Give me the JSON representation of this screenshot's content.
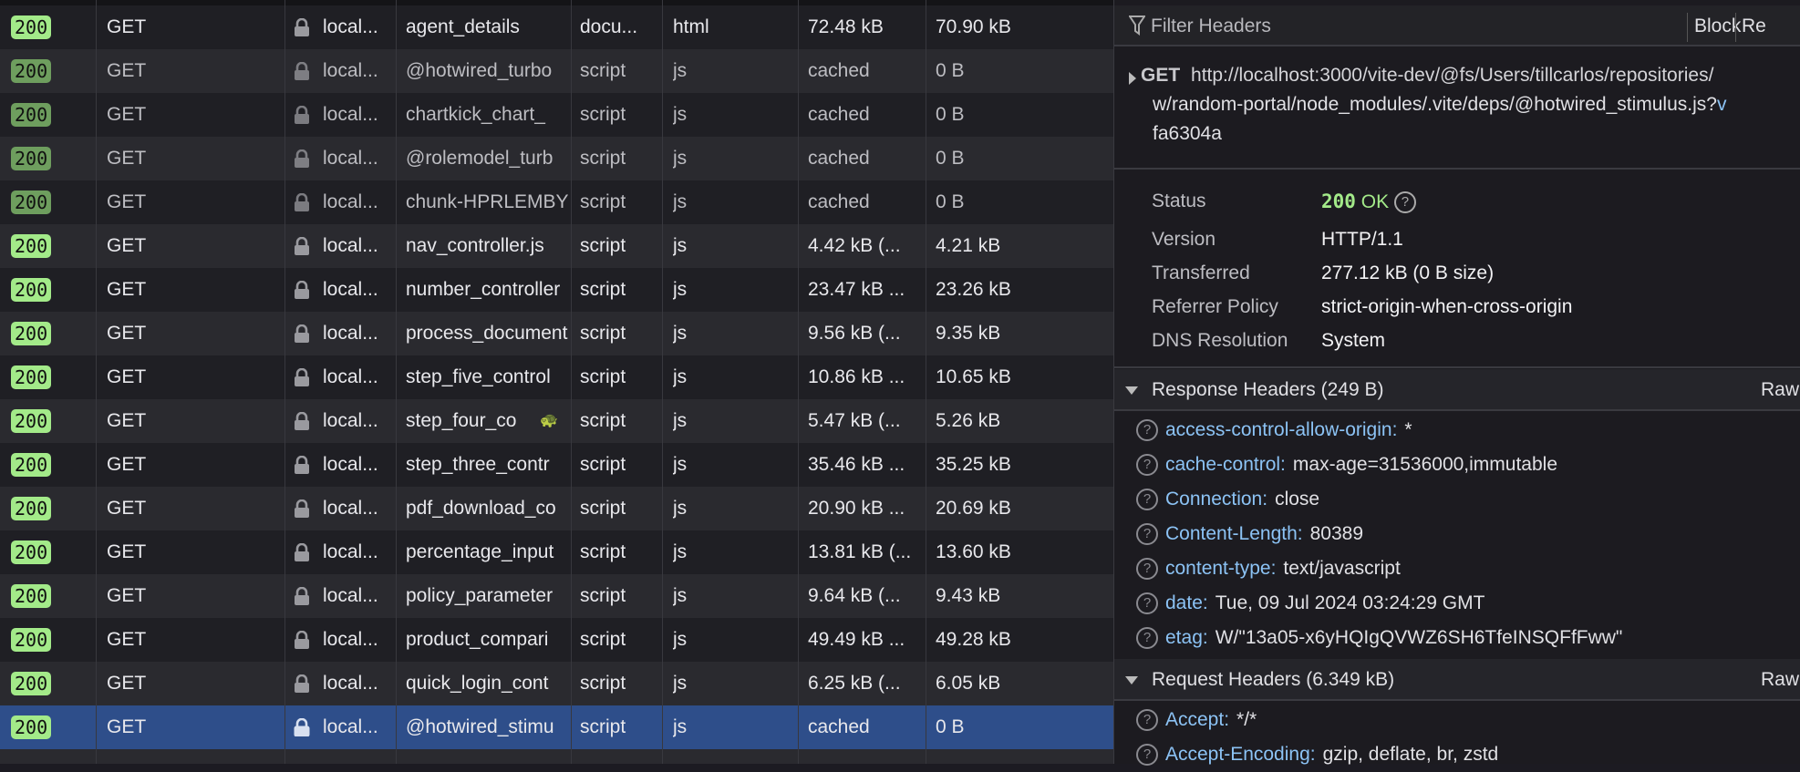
{
  "requests": [
    {
      "status": "200",
      "method": "GET",
      "domain": "local...",
      "file": "agent_details",
      "type": "docu...",
      "ext": "html",
      "transferred": "72.48 kB",
      "size": "70.90 kB",
      "cached": false
    },
    {
      "status": "200",
      "method": "GET",
      "domain": "local...",
      "file": "@hotwired_turbo",
      "type": "script",
      "ext": "js",
      "transferred": "cached",
      "size": "0 B",
      "cached": true
    },
    {
      "status": "200",
      "method": "GET",
      "domain": "local...",
      "file": "chartkick_chart_",
      "type": "script",
      "ext": "js",
      "transferred": "cached",
      "size": "0 B",
      "cached": true
    },
    {
      "status": "200",
      "method": "GET",
      "domain": "local...",
      "file": "@rolemodel_turb",
      "type": "script",
      "ext": "js",
      "transferred": "cached",
      "size": "0 B",
      "cached": true
    },
    {
      "status": "200",
      "method": "GET",
      "domain": "local...",
      "file": "chunk-HPRLEMBY",
      "type": "script",
      "ext": "js",
      "transferred": "cached",
      "size": "0 B",
      "cached": true
    },
    {
      "status": "200",
      "method": "GET",
      "domain": "local...",
      "file": "nav_controller.js",
      "type": "script",
      "ext": "js",
      "transferred": "4.42 kB (...",
      "size": "4.21 kB",
      "cached": false
    },
    {
      "status": "200",
      "method": "GET",
      "domain": "local...",
      "file": "number_controller",
      "type": "script",
      "ext": "js",
      "transferred": "23.47 kB ...",
      "size": "23.26 kB",
      "cached": false
    },
    {
      "status": "200",
      "method": "GET",
      "domain": "local...",
      "file": "process_document",
      "type": "script",
      "ext": "js",
      "transferred": "9.56 kB (...",
      "size": "9.35 kB",
      "cached": false
    },
    {
      "status": "200",
      "method": "GET",
      "domain": "local...",
      "file": "step_five_control",
      "type": "script",
      "ext": "js",
      "transferred": "10.86 kB ...",
      "size": "10.65 kB",
      "cached": false
    },
    {
      "status": "200",
      "method": "GET",
      "domain": "local...",
      "file": "step_four_co",
      "type": "script",
      "ext": "js",
      "transferred": "5.47 kB (...",
      "size": "5.26 kB",
      "cached": false,
      "slow": true
    },
    {
      "status": "200",
      "method": "GET",
      "domain": "local...",
      "file": "step_three_contr",
      "type": "script",
      "ext": "js",
      "transferred": "35.46 kB ...",
      "size": "35.25 kB",
      "cached": false
    },
    {
      "status": "200",
      "method": "GET",
      "domain": "local...",
      "file": "pdf_download_co",
      "type": "script",
      "ext": "js",
      "transferred": "20.90 kB ...",
      "size": "20.69 kB",
      "cached": false
    },
    {
      "status": "200",
      "method": "GET",
      "domain": "local...",
      "file": "percentage_input",
      "type": "script",
      "ext": "js",
      "transferred": "13.81 kB (...",
      "size": "13.60 kB",
      "cached": false
    },
    {
      "status": "200",
      "method": "GET",
      "domain": "local...",
      "file": "policy_parameter",
      "type": "script",
      "ext": "js",
      "transferred": "9.64 kB (...",
      "size": "9.43 kB",
      "cached": false
    },
    {
      "status": "200",
      "method": "GET",
      "domain": "local...",
      "file": "product_compari",
      "type": "script",
      "ext": "js",
      "transferred": "49.49 kB ...",
      "size": "49.28 kB",
      "cached": false
    },
    {
      "status": "200",
      "method": "GET",
      "domain": "local...",
      "file": "quick_login_cont",
      "type": "script",
      "ext": "js",
      "transferred": "6.25 kB (...",
      "size": "6.05 kB",
      "cached": false
    },
    {
      "status": "200",
      "method": "GET",
      "domain": "local...",
      "file": "@hotwired_stimu",
      "type": "script",
      "ext": "js",
      "transferred": "cached",
      "size": "0 B",
      "cached": true,
      "selected": true
    }
  ],
  "panel": {
    "filter_placeholder": "Filter Headers",
    "block_label": "Block",
    "resend_label": "Re",
    "request": {
      "method": "GET",
      "url_line1": "http://localhost:3000/vite-dev/@fs/Users/tillcarlos/repositories/",
      "url_line2": "w/random-portal/node_modules/.vite/deps/@hotwired_stimulus.js?",
      "url_query": "v",
      "url_line3": "fa6304a"
    },
    "summary": [
      {
        "label": "Status",
        "value": "200",
        "value2": "OK"
      },
      {
        "label": "Version",
        "value": "HTTP/1.1"
      },
      {
        "label": "Transferred",
        "value": "277.12 kB (0 B size)"
      },
      {
        "label": "Referrer Policy",
        "value": "strict-origin-when-cross-origin"
      },
      {
        "label": "DNS Resolution",
        "value": "System"
      }
    ],
    "response_headers_title": "Response Headers (249 B)",
    "raw_label": "Raw",
    "response_headers": [
      {
        "name": "access-control-allow-origin:",
        "value": "*"
      },
      {
        "name": "cache-control:",
        "value": "max-age=31536000,immutable"
      },
      {
        "name": "Connection:",
        "value": "close"
      },
      {
        "name": "Content-Length:",
        "value": "80389"
      },
      {
        "name": "content-type:",
        "value": "text/javascript"
      },
      {
        "name": "date:",
        "value": "Tue, 09 Jul 2024 03:24:29 GMT"
      },
      {
        "name": "etag:",
        "value": "W/\"13a05-x6yHQIgQVWZ6SH6TfeINSQFfFww\""
      }
    ],
    "request_headers_title": "Request Headers (6.349 kB)",
    "request_headers": [
      {
        "name": "Accept:",
        "value": "*/*"
      },
      {
        "name": "Accept-Encoding:",
        "value": "gzip, deflate, br, zstd"
      }
    ]
  },
  "colors": {
    "status_ok": "#a3ea89",
    "selected_row": "#2e4e8a",
    "header_name": "#8cc3f5"
  }
}
